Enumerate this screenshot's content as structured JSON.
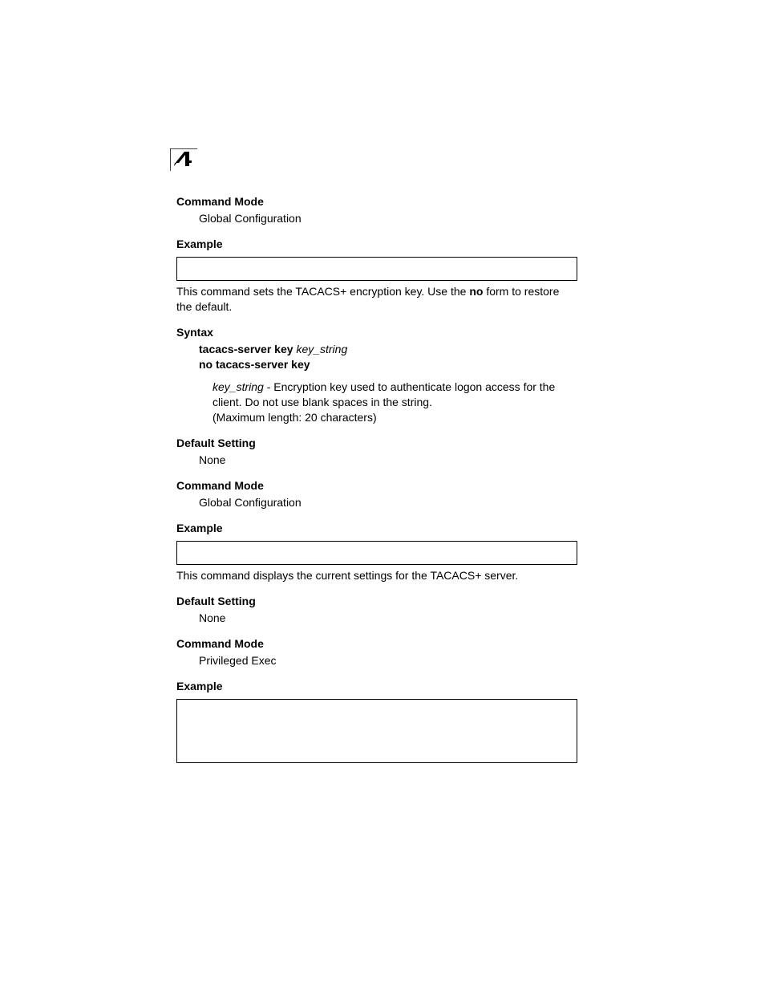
{
  "chapter_number": "4",
  "sections": [
    {
      "cmd_mode_head": "Command Mode",
      "cmd_mode_body": "Global Configuration",
      "example_head": "Example"
    },
    {
      "intro_pre": "This command sets the TACACS+ encryption key. Use the ",
      "intro_bold": "no",
      "intro_post": " form to restore the default.",
      "syntax_head": "Syntax",
      "syntax_line1_bold": "tacacs-server key ",
      "syntax_line1_ital": "key_string",
      "syntax_line2_bold": "no tacacs-server key",
      "param_ital": "key_string",
      "param_dash": " - ",
      "param_body1": "Encryption key used to authenticate logon access for the client. Do not use blank spaces in the string.",
      "param_body2": "(Maximum length: 20 characters)",
      "default_head": "Default Setting",
      "default_body": "None",
      "cmd_mode_head": "Command Mode",
      "cmd_mode_body": "Global Configuration",
      "example_head": "Example"
    },
    {
      "intro": "This command displays the current settings for the TACACS+ server.",
      "default_head": "Default Setting",
      "default_body": "None",
      "cmd_mode_head": "Command Mode",
      "cmd_mode_body": "Privileged Exec",
      "example_head": "Example"
    }
  ]
}
